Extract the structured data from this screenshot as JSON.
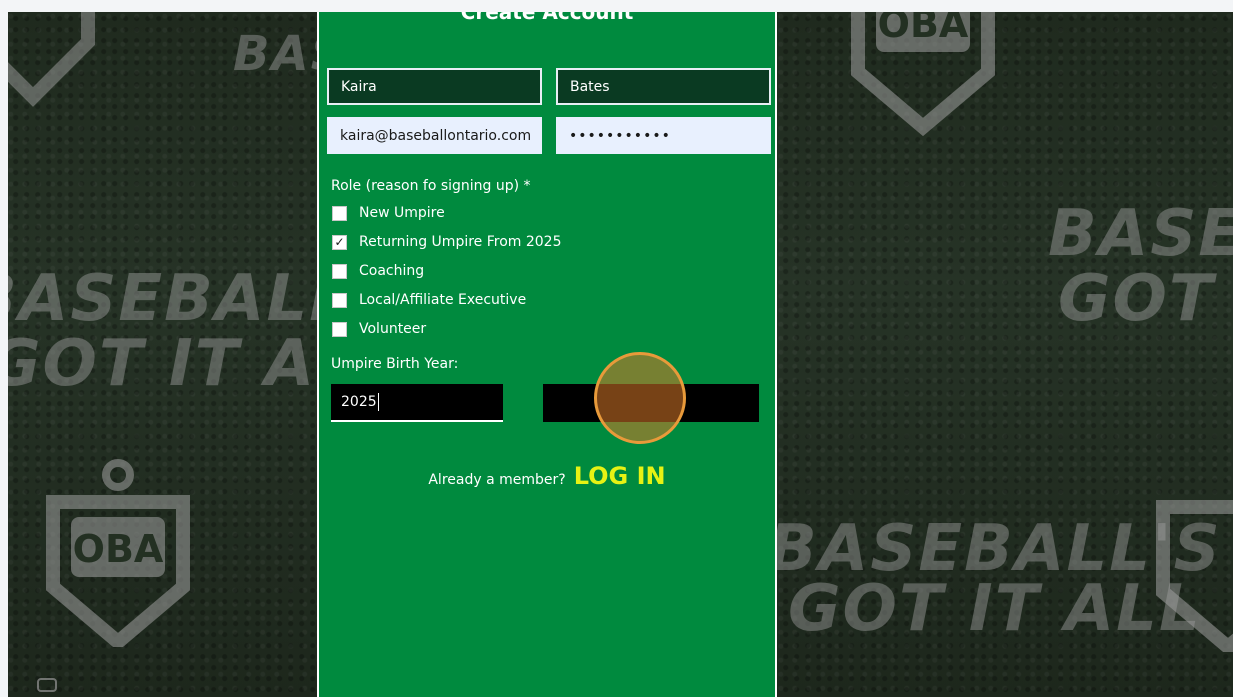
{
  "background": {
    "slogan_lines": [
      "BASEBALL'S",
      "GOT IT ALL"
    ],
    "logo_text": "OBA"
  },
  "form": {
    "title": "Create Account",
    "first_name": "Kaira",
    "last_name": "Bates",
    "email": "kaira@baseballontario.com",
    "password_masked": "•••••••••••",
    "role_label": "Role (reason fo signing up) *",
    "roles": [
      {
        "label": "New Umpire",
        "checked": false
      },
      {
        "label": "Returning Umpire From 2025",
        "checked": true
      },
      {
        "label": "Coaching",
        "checked": false
      },
      {
        "label": "Local/Affiliate Executive",
        "checked": false
      },
      {
        "label": "Volunteer",
        "checked": false
      }
    ],
    "birth_year_label": "Umpire Birth Year:",
    "birth_year_value": "2025",
    "member_prompt": "Already a member?",
    "login_label": "LOG IN"
  },
  "colors": {
    "panel_green": "#008a3e",
    "login_yellow": "#e6f214",
    "click_highlight": "#e89a3a"
  },
  "icons": {
    "check": "✓",
    "recorder": "camera-icon"
  }
}
